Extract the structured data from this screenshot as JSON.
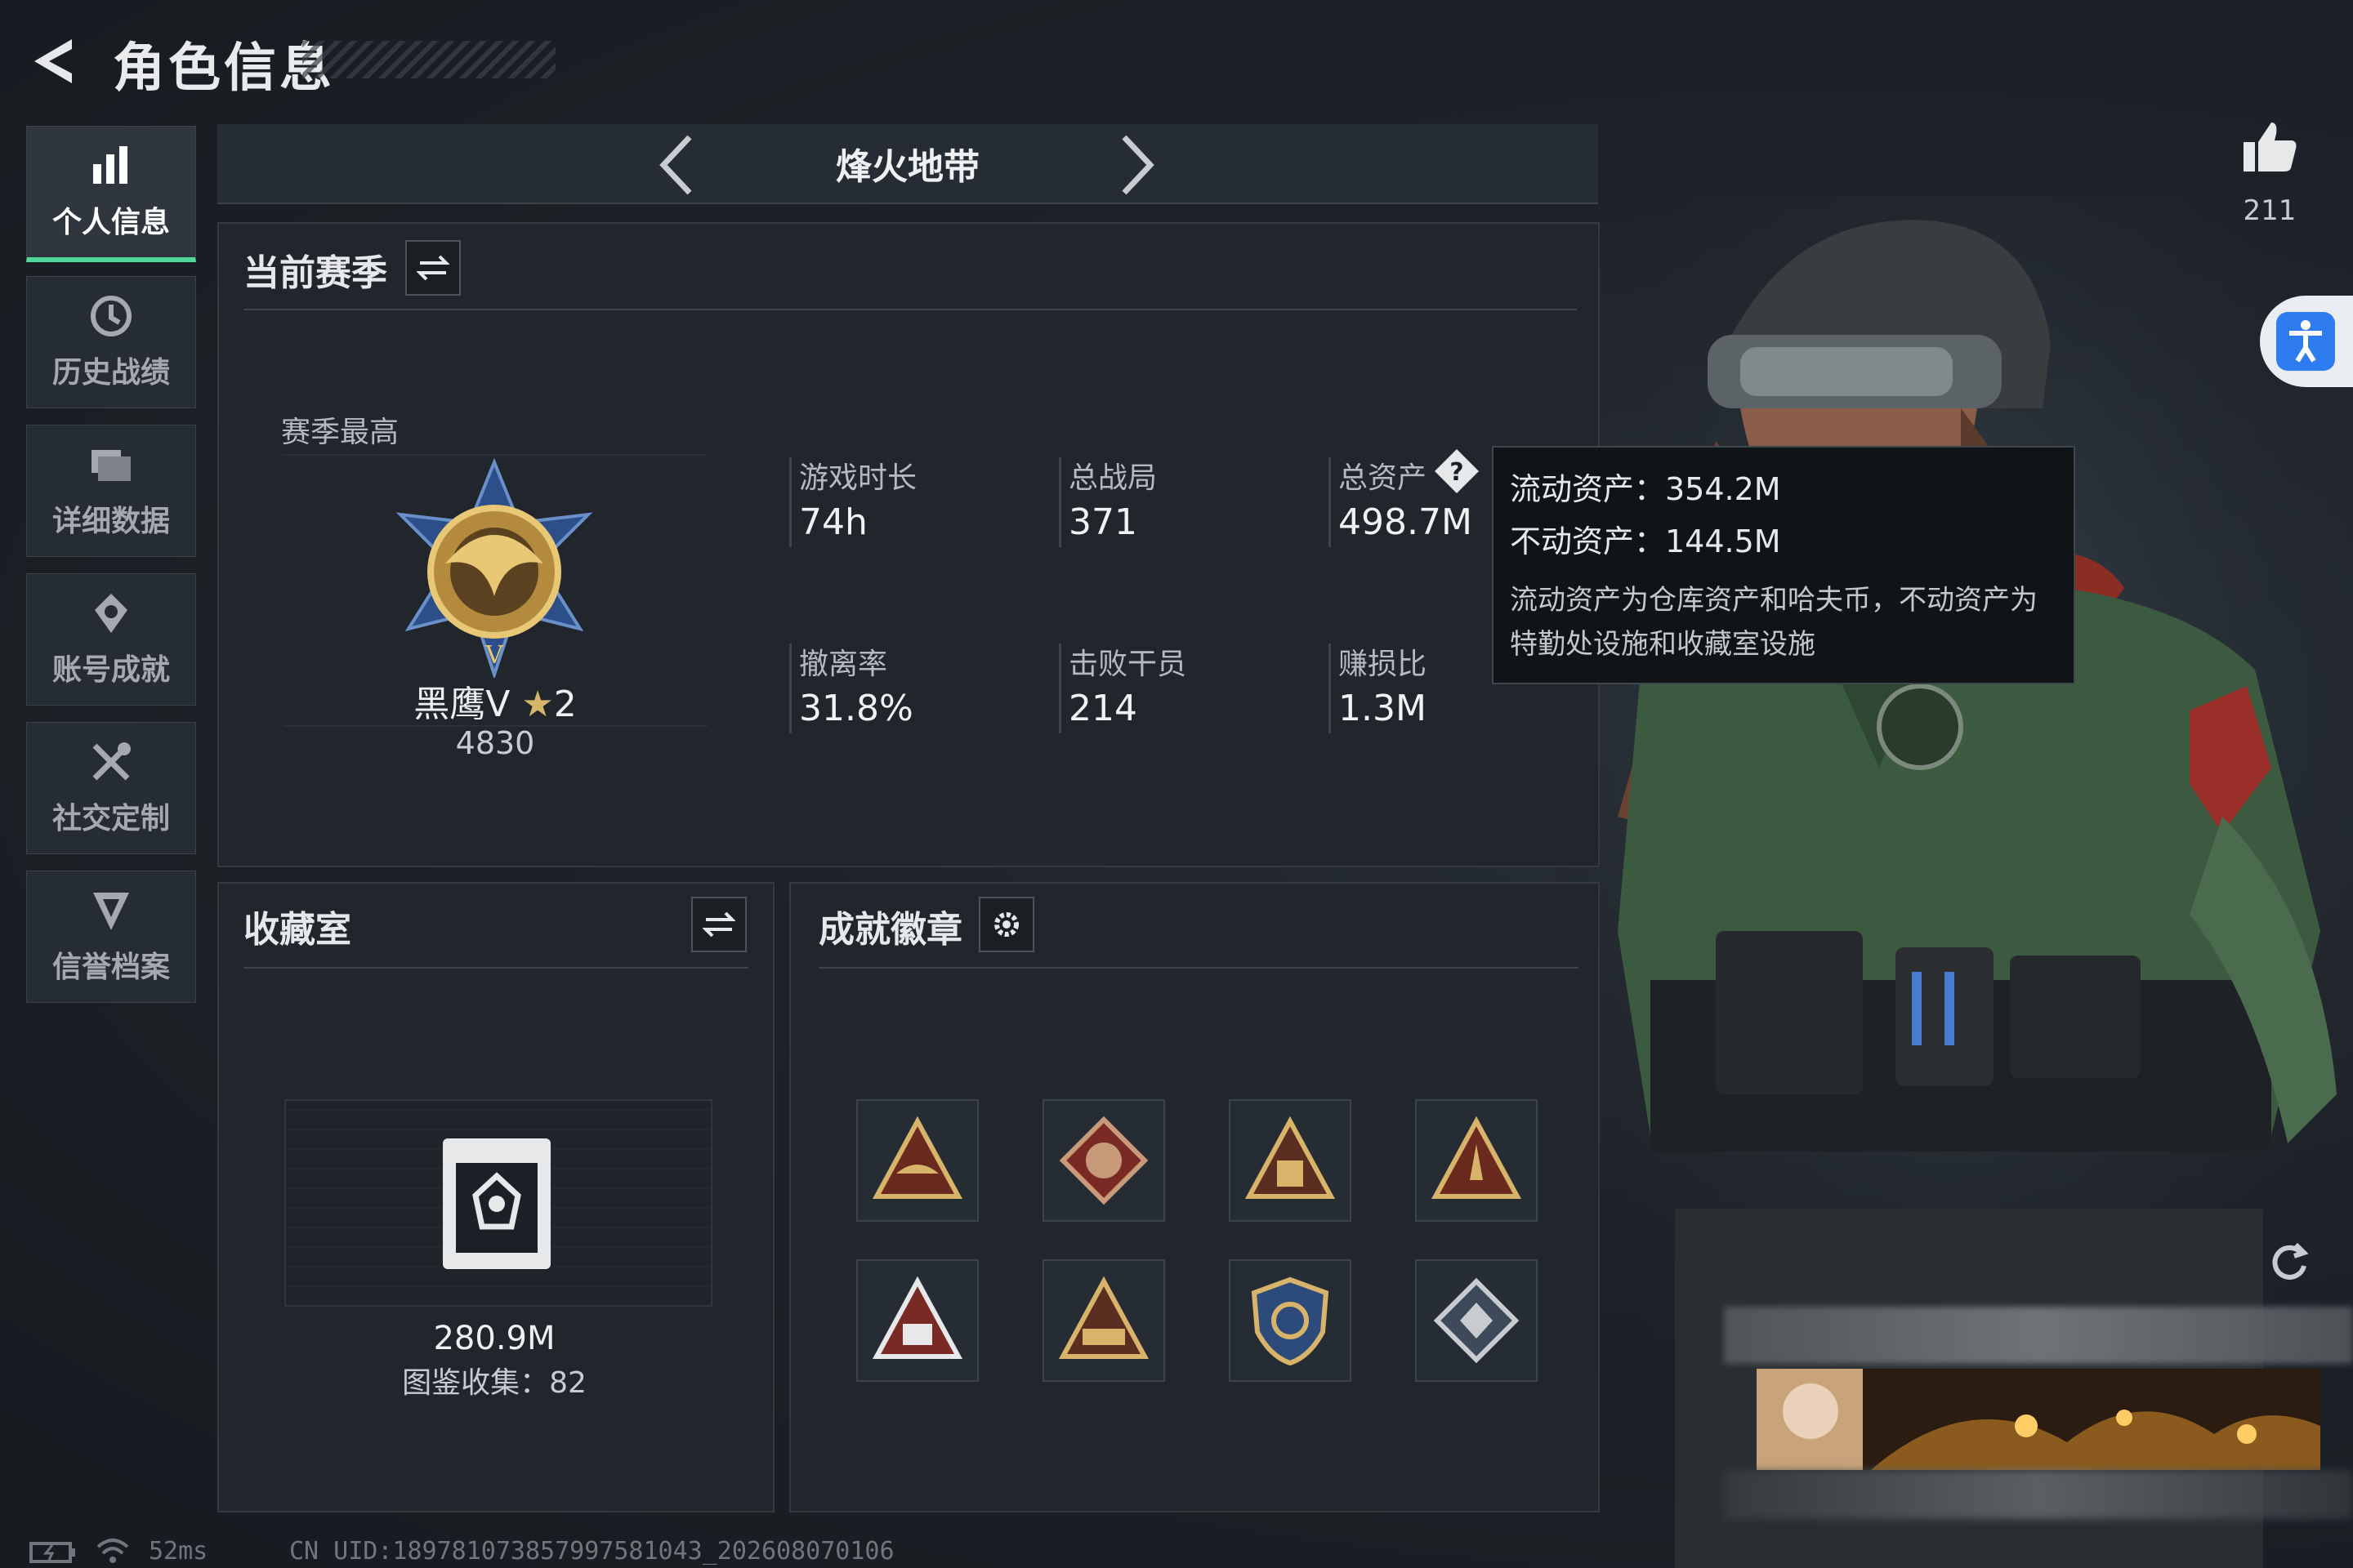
{
  "header": {
    "title": "角色信息"
  },
  "nav": {
    "items": [
      {
        "label": "个人信息",
        "icon": "bar-chart-icon",
        "active": true
      },
      {
        "label": "历史战绩",
        "icon": "history-icon",
        "active": false
      },
      {
        "label": "详细数据",
        "icon": "folder-icon",
        "active": false
      },
      {
        "label": "账号成就",
        "icon": "achievement-icon",
        "active": false
      },
      {
        "label": "社交定制",
        "icon": "tools-icon",
        "active": false
      },
      {
        "label": "信誉档案",
        "icon": "credit-icon",
        "active": false
      }
    ]
  },
  "mode": {
    "title": "烽火地带"
  },
  "season": {
    "title": "当前赛季",
    "best_label": "赛季最高",
    "rank_name": "黑鹰V",
    "rank_stars": "2",
    "rank_score": "4830",
    "stats": [
      {
        "label": "游戏时长",
        "value": "74h"
      },
      {
        "label": "总战局",
        "value": "371"
      },
      {
        "label": "总资产",
        "value": "498.7M"
      },
      {
        "label": "撤离率",
        "value": "31.8%"
      },
      {
        "label": "击败干员",
        "value": "214"
      },
      {
        "label": "赚损比",
        "value": "1.3M"
      }
    ]
  },
  "tooltip": {
    "liquid": "流动资产：354.2M",
    "fixed": "不动资产：144.5M",
    "desc": "流动资产为仓库资产和哈夫币，不动资产为特勤处设施和收藏室设施"
  },
  "collection": {
    "title": "收藏室",
    "value": "280.9M",
    "count_text": "图鉴收集：82"
  },
  "badges": {
    "title": "成就徽章",
    "items": [
      "boat-badge-icon",
      "dragon-badge-icon",
      "squad-badge-icon",
      "rocket-badge-icon",
      "crate-badge-icon",
      "vehicle-badge-icon",
      "shield-badge-icon",
      "diamond-badge-icon"
    ]
  },
  "likes": {
    "count": "211"
  },
  "status": {
    "ping": "52ms",
    "uid": "CN UID:18978107385799758104З_202608070106"
  },
  "colors": {
    "accent": "#4fd89a",
    "panel": "#20262c",
    "background": "#1c2127"
  }
}
